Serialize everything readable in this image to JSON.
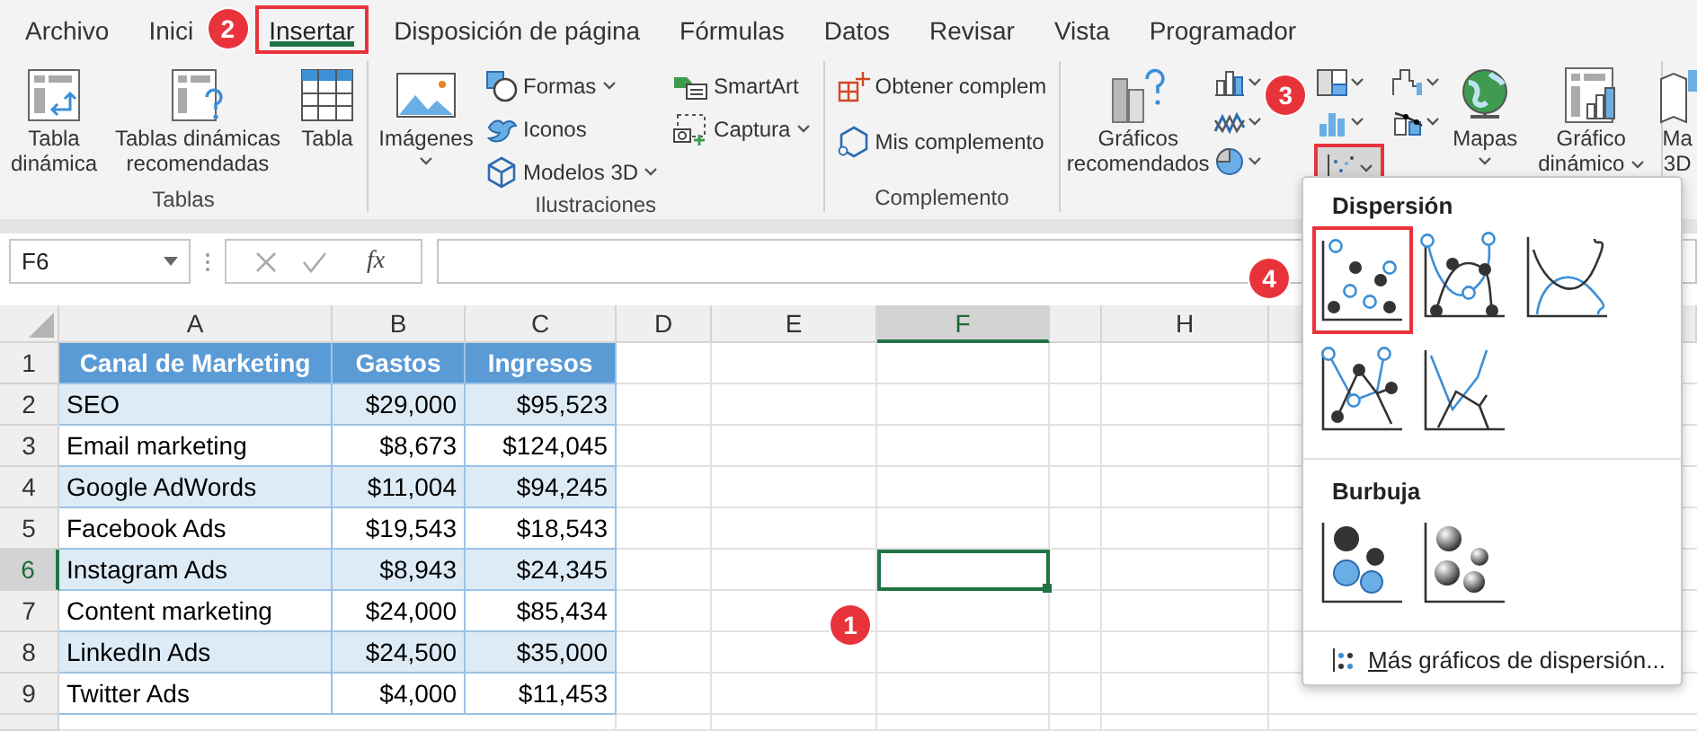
{
  "tabs": [
    {
      "label": "Archivo",
      "selected": false,
      "highlighted": false
    },
    {
      "label": "Inici",
      "selected": false,
      "highlighted": false
    },
    {
      "label": "Insertar",
      "selected": true,
      "highlighted": true
    },
    {
      "label": "Disposición de página",
      "selected": false,
      "highlighted": false
    },
    {
      "label": "Fórmulas",
      "selected": false,
      "highlighted": false
    },
    {
      "label": "Datos",
      "selected": false,
      "highlighted": false
    },
    {
      "label": "Revisar",
      "selected": false,
      "highlighted": false
    },
    {
      "label": "Vista",
      "selected": false,
      "highlighted": false
    },
    {
      "label": "Programador",
      "selected": false,
      "highlighted": false
    }
  ],
  "ribbon": {
    "groups": [
      {
        "label": "Tablas",
        "items": [
          {
            "kind": "large",
            "label": "Tabla dinámica"
          },
          {
            "kind": "large",
            "label": "Tablas dinámicas recomendadas"
          },
          {
            "kind": "large",
            "label": "Tabla"
          }
        ]
      },
      {
        "label": "Ilustraciones",
        "items": [
          {
            "kind": "large",
            "label": "Imágenes",
            "dropdown": true
          },
          {
            "kind": "small",
            "label": "Formas",
            "dropdown": true
          },
          {
            "kind": "small",
            "label": "Iconos",
            "dropdown": false
          },
          {
            "kind": "small",
            "label": "Modelos 3D",
            "dropdown": true
          },
          {
            "kind": "small",
            "label": "SmartArt",
            "dropdown": false
          },
          {
            "kind": "small",
            "label": "Captura",
            "dropdown": true
          }
        ]
      },
      {
        "label": "Complemento",
        "items": [
          {
            "kind": "small",
            "label": "Obtener complem",
            "dropdown": false
          },
          {
            "kind": "small",
            "label": "Mis complemento",
            "dropdown": false
          }
        ]
      },
      {
        "items": [
          {
            "kind": "large",
            "label": "Gráficos recomendados"
          },
          {
            "kind": "chart_grid",
            "buttons": [
              {
                "expanded": false,
                "highlighted": false
              },
              {
                "expanded": false,
                "highlighted": false
              },
              {
                "expanded": false,
                "highlighted": false
              },
              {
                "expanded": false,
                "highlighted": false
              },
              {
                "expanded": false,
                "highlighted": false
              },
              {
                "expanded": false,
                "highlighted": false
              },
              {
                "expanded": false,
                "highlighted": false
              },
              {
                "expanded": true,
                "highlighted": true
              }
            ]
          },
          {
            "kind": "large",
            "label": "Mapas",
            "dropdown": true
          },
          {
            "kind": "large",
            "label": "Gráfico dinámico",
            "dropdown": true
          }
        ]
      },
      {
        "items": [
          {
            "kind": "large",
            "label": "Ma 3D"
          }
        ]
      }
    ]
  },
  "formula_bar": {
    "name_box": "F6",
    "function_button": "fx"
  },
  "sheet": {
    "columns": [
      {
        "label": "A",
        "selected": false
      },
      {
        "label": "B",
        "selected": false
      },
      {
        "label": "C",
        "selected": false
      },
      {
        "label": "D",
        "selected": false
      },
      {
        "label": "E",
        "selected": false
      },
      {
        "label": "F",
        "selected": true
      },
      {
        "label": "H",
        "selected": false
      }
    ],
    "row_headers": [
      {
        "label": "1",
        "selected": false
      },
      {
        "label": "2",
        "selected": false
      },
      {
        "label": "3",
        "selected": false
      },
      {
        "label": "4",
        "selected": false
      },
      {
        "label": "5",
        "selected": false
      },
      {
        "label": "6",
        "selected": true
      },
      {
        "label": "7",
        "selected": false
      },
      {
        "label": "8",
        "selected": false
      },
      {
        "label": "9",
        "selected": false
      }
    ],
    "table": {
      "columns": [
        "Canal de Marketing",
        "Gastos",
        "Ingresos"
      ],
      "rows": [
        [
          "SEO",
          "$29,000",
          "$95,523"
        ],
        [
          "Email marketing",
          "$8,673",
          "$124,045"
        ],
        [
          "Google AdWords",
          "$11,004",
          "$94,245"
        ],
        [
          "Facebook Ads",
          "$19,543",
          "$18,543"
        ],
        [
          "Instagram Ads",
          "$8,943",
          "$24,345"
        ],
        [
          "Content marketing",
          "$24,000",
          "$85,434"
        ],
        [
          "LinkedIn Ads",
          "$24,500",
          "$35,000"
        ],
        [
          "Twitter Ads",
          "$4,000",
          "$11,453"
        ]
      ]
    }
  },
  "chart_menu": {
    "sections": [
      {
        "title": "Dispersión",
        "options": [
          {
            "highlighted": true
          },
          {
            "highlighted": false
          },
          {
            "highlighted": false
          },
          {
            "highlighted": false
          },
          {
            "highlighted": false
          }
        ]
      },
      {
        "title": "Burbuja",
        "options": [
          {
            "highlighted": false
          },
          {
            "highlighted": false
          }
        ]
      }
    ],
    "footer": "Más gráficos de dispersión..."
  },
  "callouts": [
    {
      "label": "1"
    },
    {
      "label": "2"
    },
    {
      "label": "3"
    },
    {
      "label": "4"
    }
  ]
}
